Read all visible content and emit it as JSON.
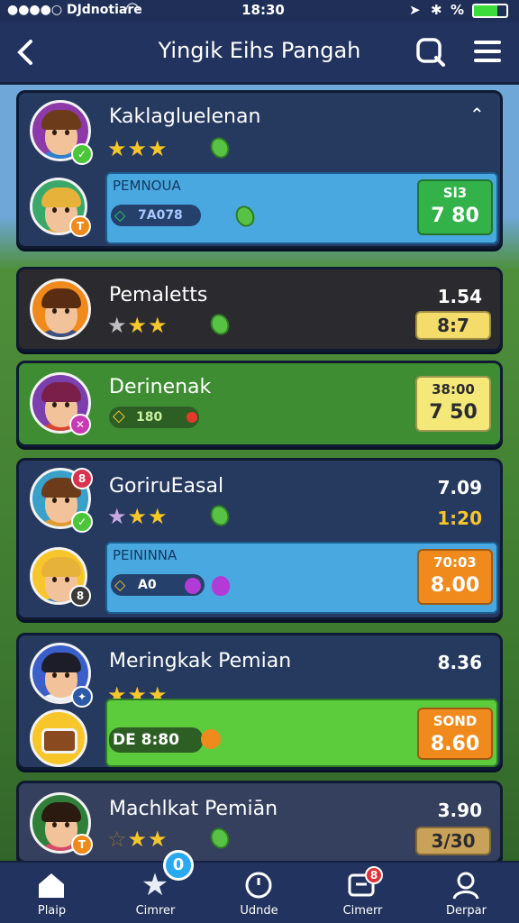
{
  "status_bar": {
    "carrier": "●●●●○ DJdnotiare",
    "time": "18:30",
    "battery_label": "%"
  },
  "header": {
    "title": "Yingik Eihs Pangah",
    "back_icon": "chevron-left-icon",
    "search_icon": "search-icon",
    "menu_icon": "hamburger-menu-icon"
  },
  "players": [
    {
      "name": "Kaklagluelenan",
      "stars": 3,
      "panel": {
        "label": "PEMNOUA",
        "pill": "7A078"
      },
      "box": {
        "small": "Sl3",
        "big": "7 80"
      }
    },
    {
      "name": "Pemaletts",
      "stars": 2,
      "value": "1.54",
      "box": {
        "big": "8:7"
      }
    },
    {
      "name": "Derinenak",
      "pill": "180",
      "box": {
        "small": "38:00",
        "big": "7 50"
      }
    },
    {
      "name": "GoriruEasal",
      "stars": 2,
      "value": "7.09",
      "value2": "1:20",
      "panel": {
        "label": "PEININNA",
        "pill": "A0"
      },
      "box": {
        "small": "70:03",
        "big": "8.00"
      }
    },
    {
      "name": "Meringkak Pemian",
      "stars": 3,
      "value": "8.36",
      "pill": "DE 8:80",
      "box": {
        "small": "SOND",
        "big": "8.60"
      }
    },
    {
      "name": "Machlkat Pemiān",
      "stars": 2,
      "value": "3.90",
      "box": {
        "big": "3/30"
      }
    }
  ],
  "tabs": [
    {
      "label": "Plaip",
      "icon": "home-icon"
    },
    {
      "label": "Cimrer",
      "icon": "star-icon",
      "badge": "0"
    },
    {
      "label": "Udnde",
      "icon": "clock-icon"
    },
    {
      "label": "Cimerr",
      "icon": "chat-icon",
      "badge": "8"
    },
    {
      "label": "Derpar",
      "icon": "profile-icon"
    }
  ],
  "colors": {
    "navy": "#26395f",
    "accent_blue": "#4aa8e0",
    "green": "#3f8d32",
    "gold": "#f7c62a",
    "orange": "#f18a1c"
  }
}
